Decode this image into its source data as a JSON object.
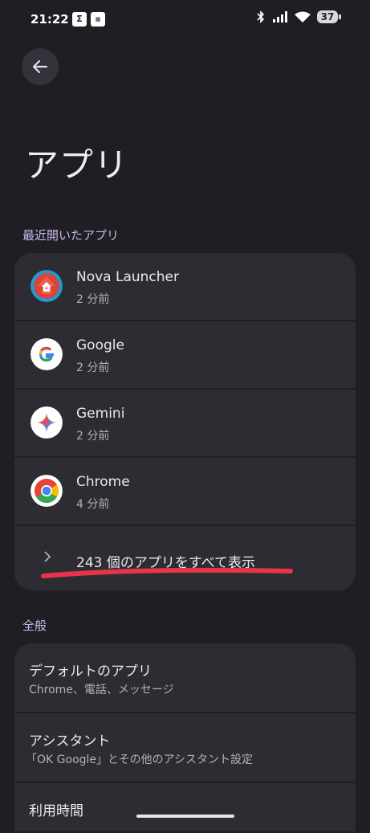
{
  "status_bar": {
    "time": "21:22",
    "notif_icons": [
      "sigma-icon",
      "news-icon"
    ],
    "battery": "37"
  },
  "header": {
    "back_icon": "arrow-left-icon",
    "title": "アプリ"
  },
  "recent": {
    "label": "最近開いたアプリ",
    "apps": [
      {
        "name": "Nova Launcher",
        "time": "2 分前",
        "icon": "nova-launcher-icon"
      },
      {
        "name": "Google",
        "time": "2 分前",
        "icon": "google-icon"
      },
      {
        "name": "Gemini",
        "time": "2 分前",
        "icon": "gemini-icon"
      },
      {
        "name": "Chrome",
        "time": "4 分前",
        "icon": "chrome-icon"
      }
    ],
    "show_all": "243 個のアプリをすべて表示"
  },
  "general": {
    "label": "全般",
    "items": [
      {
        "title": "デフォルトのアプリ",
        "sub": "Chrome、電話、メッセージ"
      },
      {
        "title": "アシスタント",
        "sub": "「OK Google」とその他のアシスタント設定"
      },
      {
        "title": "利用時間",
        "sub": ""
      }
    ]
  },
  "colors": {
    "background": "#1f1e23",
    "card": "#2e2c33",
    "section_label": "#cbb8ee",
    "annotation_underline": "#e8334a"
  }
}
